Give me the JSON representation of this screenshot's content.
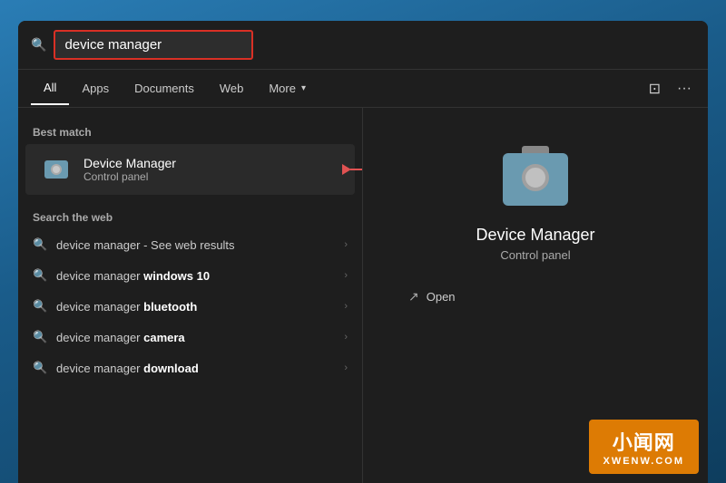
{
  "search": {
    "query": "device manager",
    "placeholder": "device manager"
  },
  "tabs": {
    "items": [
      {
        "label": "All",
        "active": true
      },
      {
        "label": "Apps",
        "active": false
      },
      {
        "label": "Documents",
        "active": false
      },
      {
        "label": "Web",
        "active": false
      },
      {
        "label": "More",
        "active": false
      }
    ]
  },
  "best_match": {
    "section_label": "Best match",
    "item": {
      "title": "Device Manager",
      "subtitle": "Control panel"
    }
  },
  "web_search": {
    "section_label": "Search the web",
    "items": [
      {
        "text": "device manager",
        "suffix": " - See web results",
        "bold": false
      },
      {
        "text": "device manager ",
        "suffix": "windows 10",
        "bold": true
      },
      {
        "text": "device manager ",
        "suffix": "bluetooth",
        "bold": true
      },
      {
        "text": "device manager ",
        "suffix": "camera",
        "bold": true
      },
      {
        "text": "device manager ",
        "suffix": "download",
        "bold": true
      }
    ]
  },
  "right_panel": {
    "title": "Device Manager",
    "subtitle": "Control panel",
    "open_label": "Open"
  },
  "watermark": {
    "main": "小闻网",
    "sub": "XWENW.COM"
  }
}
